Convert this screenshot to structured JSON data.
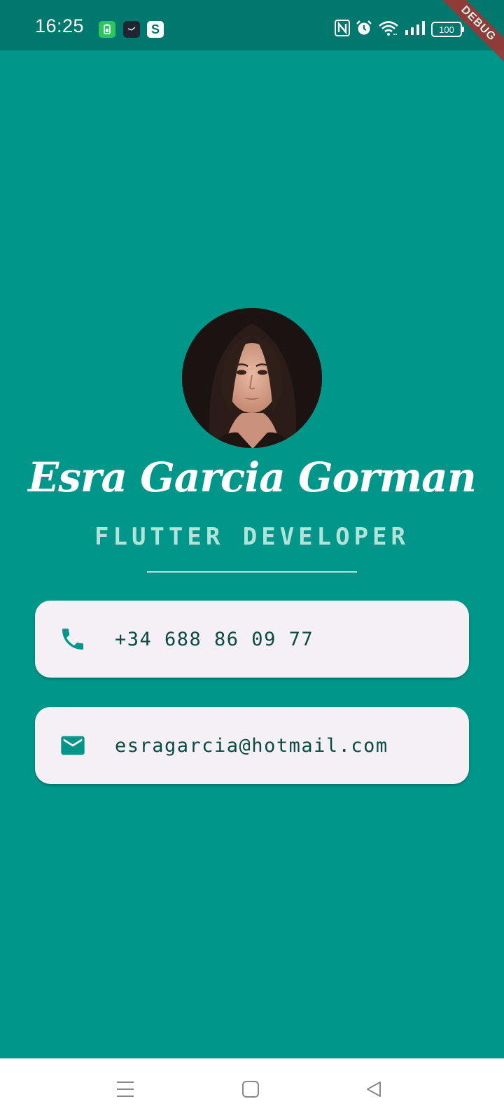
{
  "status_bar": {
    "time": "16:25",
    "battery": "100",
    "app_icons": [
      "battery-saver-icon",
      "clock-app-icon",
      "s-app-icon"
    ],
    "system_icons": [
      "nfc-icon",
      "alarm-icon",
      "wifi-icon",
      "signal-icon",
      "battery-icon"
    ]
  },
  "debug_banner": "DEBUG",
  "profile": {
    "name": "Esra Garcia Gorman",
    "title": "FLUTTER DEVELOPER"
  },
  "contacts": {
    "phone": "+34 688 86 09 77",
    "email": "esragarcia@hotmail.com"
  },
  "nav": {
    "buttons": [
      "menu-icon",
      "home-icon",
      "back-icon"
    ]
  },
  "colors": {
    "background": "#00968a",
    "status_bar": "#00786d",
    "card": "#f4f0f6",
    "accent": "#00968a",
    "subtitle": "#b2e3d9",
    "card_text": "#0c4a44"
  }
}
